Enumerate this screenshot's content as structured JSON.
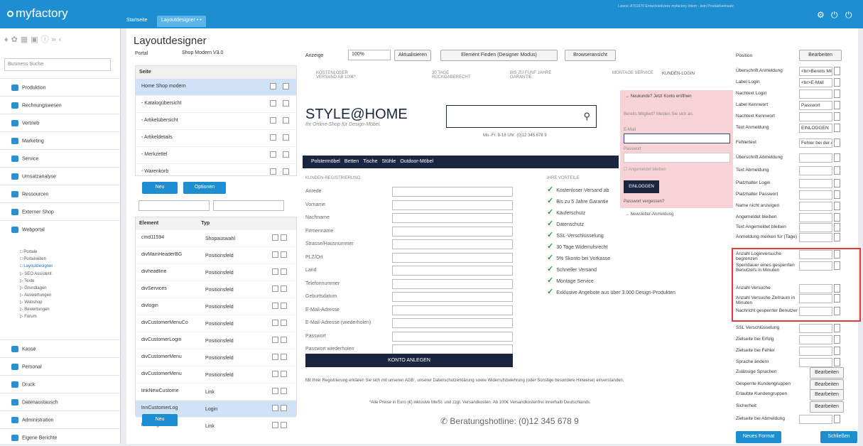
{
  "app": {
    "brand": "myfactory",
    "license": "Lizenz: A761670 Entwicklerlizenz myfactory Intern - kein Produktiveinsatz"
  },
  "tabs": [
    "Startseite",
    "Layoutdesigner • •"
  ],
  "sidebar": {
    "search_placeholder": "Business Suche",
    "items": [
      "Produktion",
      "Rechnungswesen",
      "Vertrieb",
      "Marketing",
      "Service",
      "Umsatzanalyse",
      "Ressourcen",
      "Externer Shop",
      "Webportal",
      "Kasse",
      "Personal",
      "Druck",
      "Datenaustausch",
      "Administration",
      "Eigene Berichte"
    ],
    "subitems": [
      "□ Portale",
      "□ Portalseiten",
      "□ Layoutdesigner",
      "▷ SEO Assistent",
      "▷ Texte",
      "▷ Grundlagen",
      "▷ Auswertungen",
      "▷ Webshop",
      "▷ Bewertungen",
      "▷ Forum"
    ]
  },
  "page": {
    "title": "Layoutdesigner",
    "portal_label": "Portal",
    "portal_value": "Shop Modern V3.0",
    "anzeige_label": "Anzeige",
    "zoom": "100%",
    "refresh": "Aktualisieren",
    "find": "Element Finden (Designer Modus)",
    "browser": "Browseransicht"
  },
  "pages_grid": {
    "header": "Seite",
    "rows": [
      "Home Shop modern",
      "- Katalogübersicht",
      "- Artikelübersicht",
      "- Artikeldetails",
      "- Merkzettel",
      "- Warenkorb"
    ],
    "new": "Neu",
    "options": "Optionen"
  },
  "elements_grid": {
    "col1": "Element",
    "col2": "Typ",
    "new": "Neu",
    "rows": [
      [
        "cmd11594",
        "Shopauswahl"
      ],
      [
        "divMainHeaderBG",
        "Positionsfeld"
      ],
      [
        "divheadline",
        "Positionsfeld"
      ],
      [
        "divServices",
        "Positionsfeld"
      ],
      [
        "divlogin",
        "Positionsfeld"
      ],
      [
        "divCustomerMenuCo",
        "Positionsfeld"
      ],
      [
        "divCustomerLogin",
        "Positionsfeld"
      ],
      [
        "divCustomerMenu",
        "Positionsfeld"
      ],
      [
        "divCustomerMenu",
        "Positionsfeld"
      ],
      [
        "linkNewCustome",
        "Link"
      ],
      [
        "lnnCustomerLog",
        "Login"
      ],
      [
        "linkForgotPassw",
        "Link"
      ]
    ]
  },
  "preview": {
    "features": [
      "KOSTENLOSER VERSAND AB 100€*",
      "30 TAGE RÜCKGABERECHT",
      "BIS ZU FÜNF JAHRE GARANTIE",
      "MONTAGE SERVICE"
    ],
    "kundenlogin": "KUNDEN-LOGIN",
    "shop_title": "STYLE@HOME",
    "shop_sub": "Ihr Online-Shop für Design-Möbel.",
    "hotline_small": "Mo.-Fr. 8-18 Uhr: (0)12 345 678 9",
    "nav": [
      "Polstermöbel",
      "Betten",
      "Tische",
      "Stühle",
      "Outdoor-Möbel"
    ],
    "reg_title": "KUNDEN-REGISTRIERUNG",
    "fields": [
      "Anrede",
      "Vorname",
      "Nachname",
      "Firmenname",
      "Strasse/Hausnummer",
      "PLZ/Ort",
      "Land",
      "Telefonnummer",
      "Geburtsdatum",
      "E-Mail-Adresse",
      "E-Mail-Adresse (wiederholen)",
      "Passwort",
      "Passwort wiederholen"
    ],
    "create": "KONTO ANLEGEN",
    "adv_title": "IHRE VORTEILE",
    "advantages": [
      "Kostenloser Versand ab",
      "Bis zu 5 Jahre Garantie",
      "Käuferschutz",
      "Datenschutz",
      "SSL-Verschlüsselung",
      "30 Tage Widerrufsrecht",
      "5% Skonto bei Vorkasse",
      "Schneller Versand",
      "Montage Service",
      "Exklusive Angebote aus über 3.000 Design-Produkten"
    ],
    "login": {
      "newcust": "→ Neukunde? Jetzt Konto eröffnen",
      "already": "Bereits Mitglied? Melden Sie sich an.",
      "email": "E-Mail",
      "password": "Passwort",
      "remember": "Angemeldet bleiben",
      "btn": "EINLOGGEN",
      "forgot": "Passwort vergessen?",
      "newsletter": "→ Newsletter-Anmeldung"
    },
    "legal": "Mit Ihrer Registrierung erklären Sie sich mit unseren AGB , unserer Datenschutzerklärung sowie Widerrufsbelehrung (oder Sonstige besondere Hinweise) einverstanden.",
    "prices": "*Alle Preise in Euro (€) inklusive MwSt. und zzgl. Versandkosten. Ab 100€ Versandkostenfrei innerhalb Deutschlands.",
    "hotline": "Beratungshotline: (0)12 345 678 9"
  },
  "props": {
    "position": "Position",
    "edit": "Bearbeiten",
    "rows": [
      [
        "Überschrift Anmeldung",
        "<br>Bereits Mitgli"
      ],
      [
        "Label Login",
        "<br>E-Mail"
      ],
      [
        "Nachtext Login",
        ""
      ],
      [
        "Label Kennwort",
        "Passwort"
      ],
      [
        "Nachtext Kennwort",
        ""
      ],
      [
        "Text Anmeldung",
        "EINLOGGEN"
      ],
      [
        "Fehlertext",
        "Fehler bei der Anr"
      ],
      [
        "Überschrift Abmeldung",
        ""
      ],
      [
        "Text Abmeldung",
        ""
      ],
      [
        "Platzhalter Login",
        ""
      ],
      [
        "Platzhalter Passwort",
        ""
      ],
      [
        "Name nicht anzeigen",
        ""
      ],
      [
        "Angemeldet bleiben",
        ""
      ],
      [
        "Text Angemeldet bleiben",
        ""
      ],
      [
        "Anmeldung merken für (Tage)",
        ""
      ],
      [
        "Anzahl Loginversuche begrenzen",
        ""
      ],
      [
        "Sperrdauer eines gesperrten Benutzers in Minuten",
        ""
      ],
      [
        "Anzahl Versuche",
        ""
      ],
      [
        "Anzahl Versuche Zeitraum in Minuten",
        ""
      ],
      [
        "Nachricht gesperrter Benutzer",
        ""
      ],
      [
        "SSL Verschlüsselung",
        ""
      ],
      [
        "Zielseite bei Erfolg",
        ""
      ],
      [
        "Zielseite bei Fehler",
        ""
      ],
      [
        "Sprache ändern",
        ""
      ],
      [
        "Zulässige Sprachen",
        "Bearbeiten"
      ],
      [
        "Gesperrte Kundengruppen",
        "Bearbeiten"
      ],
      [
        "Erlaubte Kundengruppen",
        "Bearbeiten"
      ],
      [
        "Sicherheit",
        "Bearbeiten"
      ],
      [
        "Zielseite bei Abmeldung",
        ""
      ]
    ],
    "newformat": "Neues Format",
    "close": "Schließen"
  }
}
